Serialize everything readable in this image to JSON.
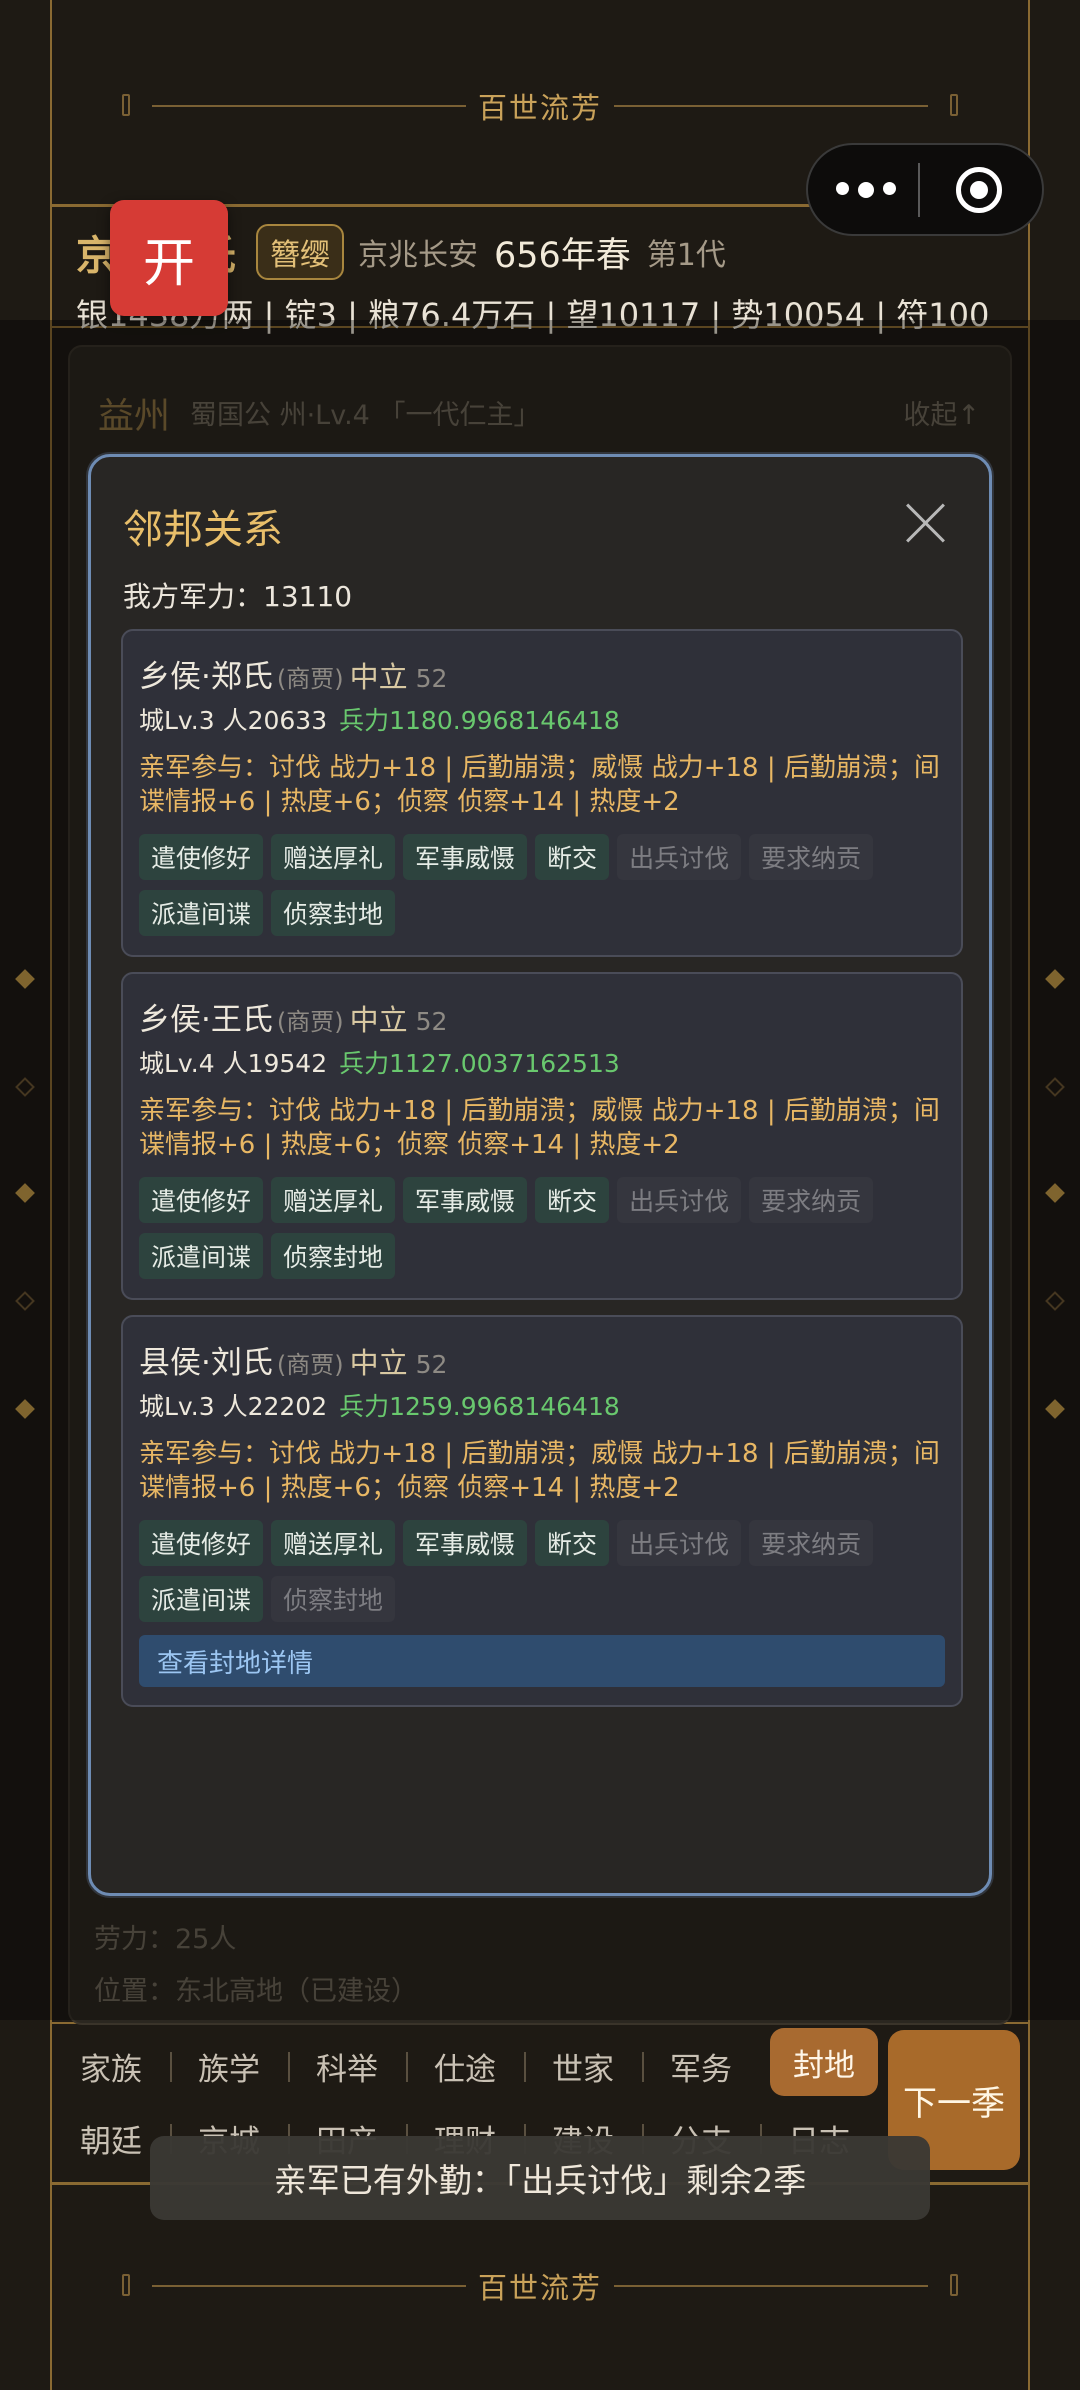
{
  "top_banner": "百世流芳",
  "bottom_banner": "百世流芳",
  "header": {
    "clan_name": "京兆韦氏",
    "badge": "簪缨",
    "location": "京兆长安",
    "season": "656年春",
    "generation": "第1代",
    "resources": "银1438万两 | 锭3 | 粮76.4万石 | 望10117 | 势10054 | 符100"
  },
  "open_button": "开",
  "background_panel": {
    "region": "益州",
    "title": "蜀国公",
    "level": "州·Lv.4 「一代仁主」",
    "collapse": "收起↑",
    "labor": "劳力：25人",
    "position": "位置：东北高地（已建设）"
  },
  "modal": {
    "title": "邻邦关系",
    "my_power": "我方军力：13110",
    "cards": [
      {
        "name": "乡侯·郑氏",
        "tag": "(商贾)",
        "stance": "中立",
        "score": "52",
        "stats": "城Lv.3  人20633",
        "troops": "兵力1180.9968146418",
        "note": "亲军参与：讨伐 战力+18 | 后勤崩溃；威慑 战力+18 | 后勤崩溃；间谍情报+6 | 热度+6；侦察 侦察+14 | 热度+2",
        "buttons": [
          "遣使修好",
          "赠送厚礼",
          "军事威慑",
          "断交",
          "出兵讨伐",
          "要求纳贡",
          "派遣间谍",
          "侦察封地"
        ]
      },
      {
        "name": "乡侯·王氏",
        "tag": "(商贾)",
        "stance": "中立",
        "score": "52",
        "stats": "城Lv.4  人19542",
        "troops": "兵力1127.0037162513",
        "note": "亲军参与：讨伐 战力+18 | 后勤崩溃；威慑 战力+18 | 后勤崩溃；间谍情报+6 | 热度+6；侦察 侦察+14 | 热度+2",
        "buttons": [
          "遣使修好",
          "赠送厚礼",
          "军事威慑",
          "断交",
          "出兵讨伐",
          "要求纳贡",
          "派遣间谍",
          "侦察封地"
        ]
      },
      {
        "name": "县侯·刘氏",
        "tag": "(商贾)",
        "stance": "中立",
        "score": "52",
        "stats": "城Lv.3  人22202",
        "troops": "兵力1259.9968146418",
        "note": "亲军参与：讨伐 战力+18 | 后勤崩溃；威慑 战力+18 | 后勤崩溃；间谍情报+6 | 热度+6；侦察 侦察+14 | 热度+2",
        "buttons": [
          "遣使修好",
          "赠送厚礼",
          "军事威慑",
          "断交",
          "出兵讨伐",
          "要求纳贡",
          "派遣间谍",
          "侦察封地"
        ],
        "detail": "查看封地详情"
      }
    ]
  },
  "nav": {
    "row1": [
      "家族",
      "族学",
      "科举",
      "仕途",
      "世家",
      "军务",
      "封地"
    ],
    "row2": [
      "朝廷",
      "京城",
      "田产",
      "理财",
      "建设",
      "分支",
      "日志"
    ],
    "active": "封地",
    "next": "下一季"
  },
  "toast": "亲军已有外勤：「出兵讨伐」剩余2季"
}
